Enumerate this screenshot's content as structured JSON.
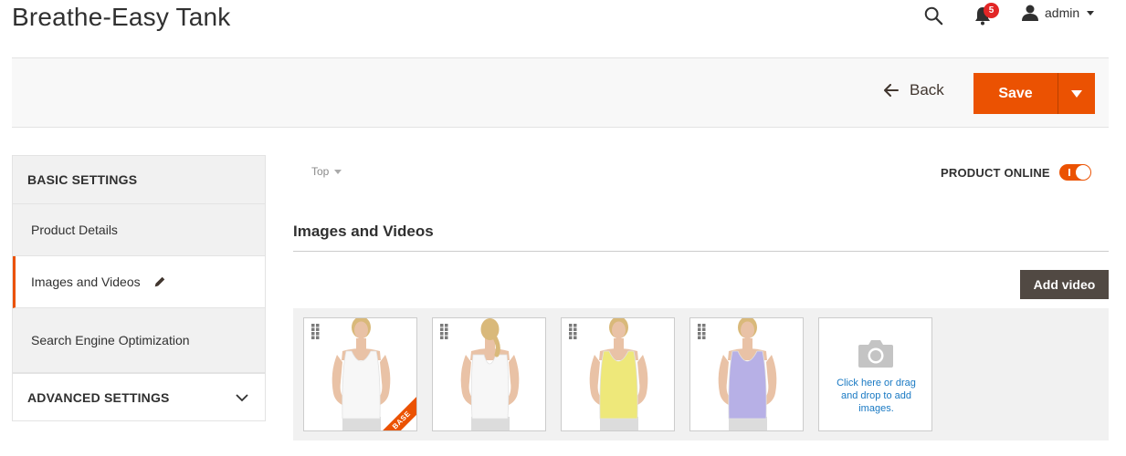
{
  "header": {
    "title": "Breathe-Easy Tank",
    "notifications_count": "5",
    "user_name": "admin"
  },
  "action_bar": {
    "back_label": "Back",
    "save_label": "Save"
  },
  "sidebar": {
    "basic_heading": "BASIC SETTINGS",
    "items": [
      {
        "label": "Product Details"
      },
      {
        "label": "Images and Videos"
      },
      {
        "label": "Search Engine Optimization"
      }
    ],
    "advanced_heading": "ADVANCED SETTINGS"
  },
  "main": {
    "scope_label": "Top",
    "online_label": "PRODUCT ONLINE",
    "online": true,
    "section_title": "Images and Videos",
    "add_video_label": "Add video",
    "base_badge": "BASE",
    "upload_text": "Click here or drag and drop to add images.",
    "images": [
      {
        "view": "front",
        "color": "#f7f7f7",
        "base": true
      },
      {
        "view": "back",
        "color": "#f7f7f7",
        "base": false
      },
      {
        "view": "front",
        "color": "#eee87a",
        "base": false
      },
      {
        "view": "front",
        "color": "#b7b0e6",
        "base": false
      }
    ]
  },
  "colors": {
    "accent": "#eb5202",
    "dark_button": "#514943",
    "link": "#1979c3"
  }
}
